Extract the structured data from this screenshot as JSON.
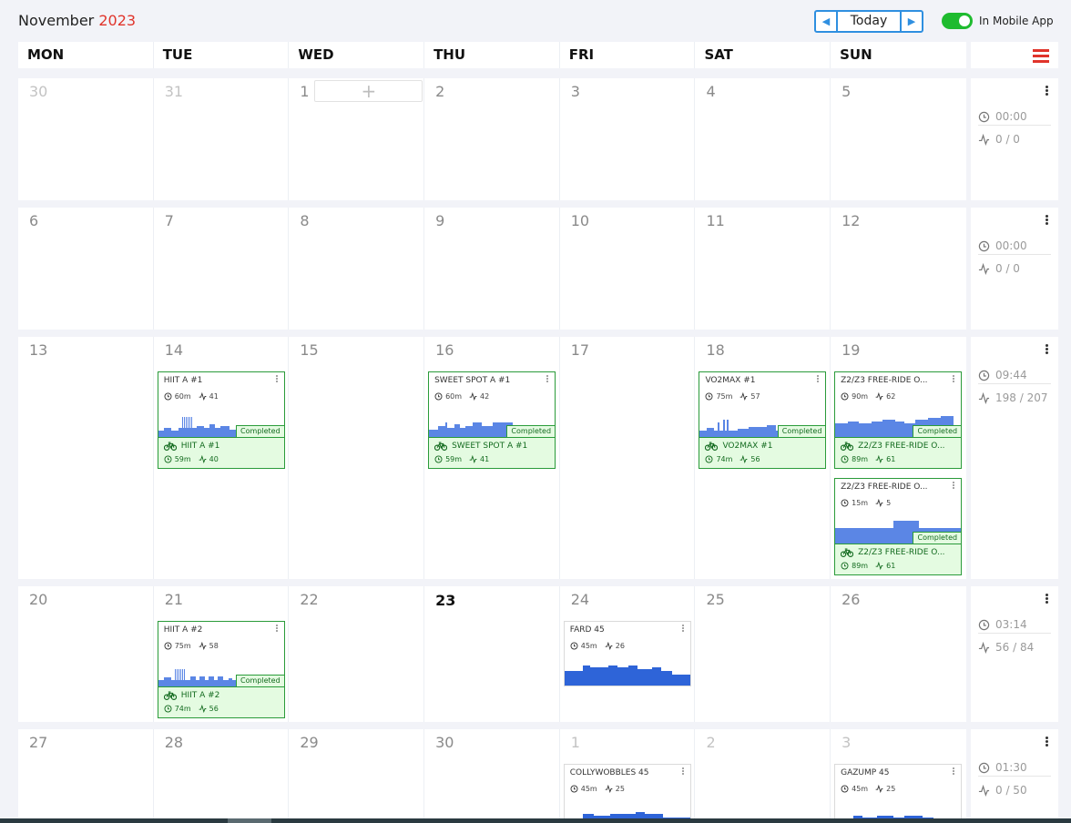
{
  "header": {
    "month": "November",
    "year": "2023",
    "today_label": "Today",
    "mobile_label": "In Mobile App",
    "toggle_on": true,
    "accent": "#e0342b",
    "nav_color": "#2f8fe0",
    "toggle_color": "#1fbb2f"
  },
  "days_of_week": [
    "MON",
    "TUE",
    "WED",
    "THU",
    "FRI",
    "SAT",
    "SUN"
  ],
  "weeks": [
    {
      "days": [
        "30",
        "31",
        "1",
        "2",
        "3",
        "4",
        "5"
      ],
      "summary": {
        "time": "00:00",
        "load": "0 / 0"
      }
    },
    {
      "days": [
        "6",
        "7",
        "8",
        "9",
        "10",
        "11",
        "12"
      ],
      "summary": {
        "time": "00:00",
        "load": "0 / 0"
      }
    },
    {
      "days": [
        "13",
        "14",
        "15",
        "16",
        "17",
        "18",
        "19"
      ],
      "summary": {
        "time": "09:44",
        "load": "198 / 207"
      }
    },
    {
      "days": [
        "20",
        "21",
        "22",
        "23",
        "24",
        "25",
        "26"
      ],
      "summary": {
        "time": "03:14",
        "load": "56 / 84"
      }
    },
    {
      "days": [
        "27",
        "28",
        "29",
        "30",
        "1",
        "2",
        "3"
      ],
      "summary": {
        "time": "01:30",
        "load": "0 / 50"
      }
    }
  ],
  "add_symbol": "+",
  "workouts": {
    "w14": {
      "title": "HIIT A #1",
      "dur": "60m",
      "tss": "41",
      "badge": "Completed",
      "done_title": "HIIT A #1",
      "done_dur": "59m",
      "done_tss": "40"
    },
    "w16": {
      "title": "SWEET SPOT A #1",
      "dur": "60m",
      "tss": "42",
      "badge": "Completed",
      "done_title": "SWEET SPOT A #1",
      "done_dur": "59m",
      "done_tss": "41"
    },
    "w18": {
      "title": "VO2MAX #1",
      "dur": "75m",
      "tss": "57",
      "badge": "Completed",
      "done_title": "VO2MAX #1",
      "done_dur": "74m",
      "done_tss": "56"
    },
    "w19a": {
      "title": "Z2/Z3 FREE-RIDE O...",
      "dur": "90m",
      "tss": "62",
      "badge": "Completed",
      "done_title": "Z2/Z3 FREE-RIDE O...",
      "done_dur": "89m",
      "done_tss": "61"
    },
    "w19b": {
      "title": "Z2/Z3 FREE-RIDE O...",
      "dur": "15m",
      "tss": "5",
      "badge": "Completed",
      "done_title": "Z2/Z3 FREE-RIDE O...",
      "done_dur": "89m",
      "done_tss": "61"
    },
    "w21": {
      "title": "HIIT A #2",
      "dur": "75m",
      "tss": "58",
      "badge": "Completed",
      "done_title": "HIIT A #2",
      "done_dur": "74m",
      "done_tss": "56"
    },
    "w24": {
      "title": "FARD 45",
      "dur": "45m",
      "tss": "26"
    },
    "w1": {
      "title": "COLLYWOBBLES 45",
      "dur": "45m",
      "tss": "25"
    },
    "w3": {
      "title": "GAZUMP 45",
      "dur": "45m",
      "tss": "25"
    }
  },
  "colors": {
    "planned": "#5b86e5",
    "plan_dark": "#2e64d8",
    "done_bg": "#e4fbe1",
    "done_border": "#2a9b3a"
  }
}
